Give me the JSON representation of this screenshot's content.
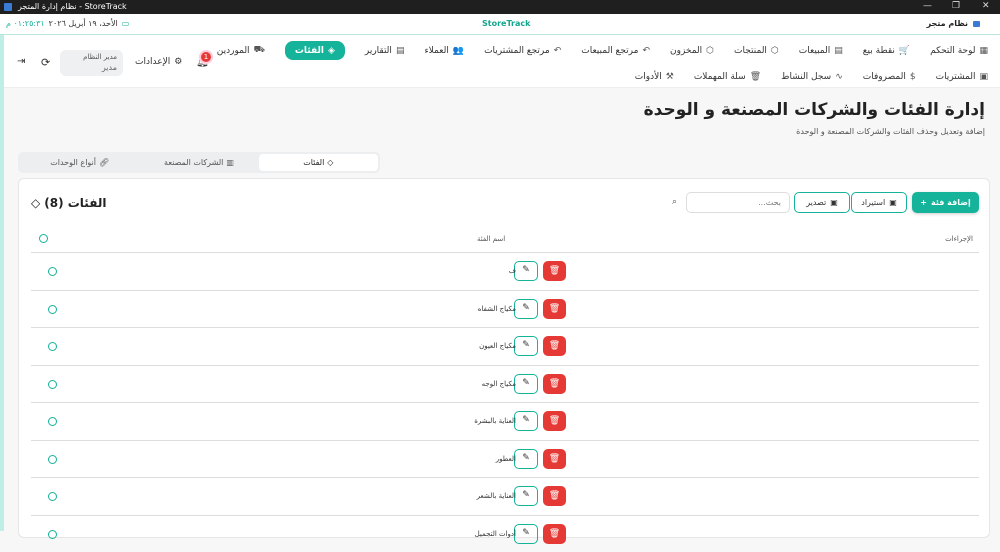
{
  "window": {
    "title": "نظام إدارة المتجر - StoreTrack",
    "minimize": "—",
    "maximize": "❐",
    "close": "✕"
  },
  "topbar": {
    "date": "الأحد، ١٩ أبريل ٢٠٢٦",
    "time": "٠١:٢٥:٣١ م",
    "brand": "StoreTrack",
    "app_name": "نظام متجر"
  },
  "nav": {
    "row1": [
      {
        "label": "لوحة التحكم",
        "icon": "▦"
      },
      {
        "label": "نقطة بيع",
        "icon": "🛒"
      },
      {
        "label": "المبيعات",
        "icon": "▤"
      },
      {
        "label": "المنتجات",
        "icon": "⬡"
      },
      {
        "label": "المخزون",
        "icon": "⬡"
      },
      {
        "label": "مرتجع المبيعات",
        "icon": "↶"
      },
      {
        "label": "مرتجع المشتريات",
        "icon": "↶"
      },
      {
        "label": "العملاء",
        "icon": "👥"
      },
      {
        "label": "التقارير",
        "icon": "▤"
      },
      {
        "label": "الفئات",
        "icon": "◈",
        "active": true
      },
      {
        "label": "الموردين",
        "icon": "⛟"
      }
    ],
    "row2": [
      {
        "label": "المشتريات",
        "icon": "▣"
      },
      {
        "label": "المصروفات",
        "icon": "$"
      },
      {
        "label": "سجل النشاط",
        "icon": "∿"
      },
      {
        "label": "سلة المهملات",
        "icon": "🗑"
      },
      {
        "label": "الأدوات",
        "icon": "⚒"
      }
    ]
  },
  "user": {
    "name": "مدير النظام",
    "role": "مدير"
  },
  "notifications": {
    "count": "1"
  },
  "settings_label": "الإعدادات",
  "page": {
    "title": "إدارة الفئات والشركات المصنعة و الوحدة",
    "subtitle": "إضافة وتعديل وحذف الفئات والشركات المصنعة و الوحدة"
  },
  "tabs": [
    {
      "label": "أنواع الوحدات"
    },
    {
      "label": "الشركات المصنعة"
    },
    {
      "label": "الفئات",
      "active": true
    }
  ],
  "card": {
    "title": "الفئات (8)",
    "search_placeholder": "بحث...",
    "add_label": "إضافة فئة",
    "import_label": "استيراد",
    "export_label": "تصدير"
  },
  "table": {
    "headers": {
      "actions": "الإجراءات",
      "name": "اسم الفئة"
    },
    "rows": [
      {
        "name": "ف"
      },
      {
        "name": "مكياج الشفاه"
      },
      {
        "name": "مكياج العيون"
      },
      {
        "name": "مكياج الوجه"
      },
      {
        "name": "العناية بالبشرة"
      },
      {
        "name": "العطور"
      },
      {
        "name": "العناية بالشعر"
      },
      {
        "name": "أدوات التجميل"
      }
    ]
  },
  "colors": {
    "accent": "#14b39a",
    "danger": "#e53935"
  }
}
